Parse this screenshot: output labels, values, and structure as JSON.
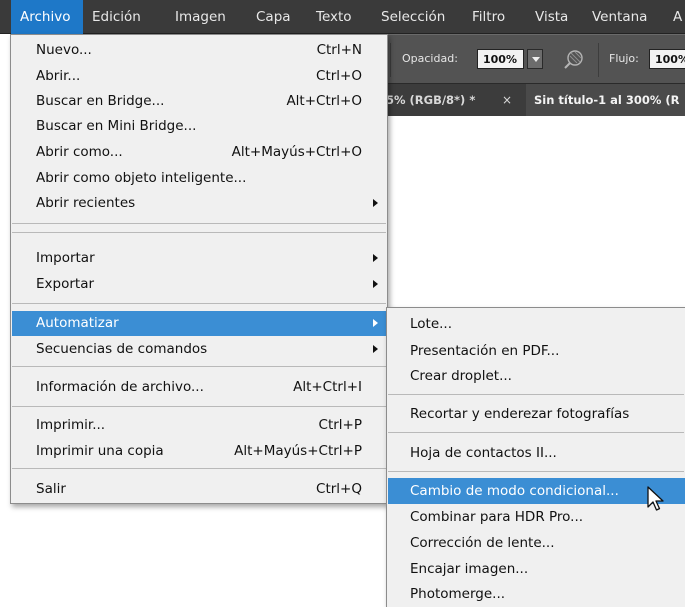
{
  "menubar": {
    "items": [
      "Archivo",
      "Edición",
      "Imagen",
      "Capa",
      "Texto",
      "Selección",
      "Filtro",
      "Vista",
      "Ventana",
      "A"
    ],
    "active_index": 0
  },
  "options_bar": {
    "opacity_label": "Opacidad:",
    "opacity_value": "100%",
    "flow_label": "Flujo:",
    "flow_value": "100%",
    "airbrush_icon": "airbrush-icon"
  },
  "document_tabs": [
    {
      "label": "5% (RGB/8*) *",
      "close": "×"
    },
    {
      "label": "Sin título-1 al 300% (R"
    }
  ],
  "file_menu": {
    "items": [
      {
        "label": "Nuevo...",
        "shortcut": "Ctrl+N"
      },
      {
        "label": "Abrir...",
        "shortcut": "Ctrl+O"
      },
      {
        "label": "Buscar en Bridge...",
        "shortcut": "Alt+Ctrl+O"
      },
      {
        "label": "Buscar en Mini Bridge...",
        "shortcut": ""
      },
      {
        "label": "Abrir como...",
        "shortcut": "Alt+Mayús+Ctrl+O"
      },
      {
        "label": "Abrir como objeto inteligente...",
        "shortcut": ""
      },
      {
        "label": "Abrir recientes",
        "submenu": true
      },
      {
        "label": "Importar",
        "submenu": true
      },
      {
        "label": "Exportar",
        "submenu": true
      },
      {
        "label": "Automatizar",
        "submenu": true,
        "highlighted": true
      },
      {
        "label": "Secuencias de comandos",
        "submenu": true
      },
      {
        "label": "Información de archivo...",
        "shortcut": "Alt+Ctrl+I"
      },
      {
        "label": "Imprimir...",
        "shortcut": "Ctrl+P"
      },
      {
        "label": "Imprimir una copia",
        "shortcut": "Alt+Mayús+Ctrl+P"
      },
      {
        "label": "Salir",
        "shortcut": "Ctrl+Q"
      }
    ]
  },
  "automate_submenu": {
    "items": [
      {
        "label": "Lote..."
      },
      {
        "label": "Presentación en PDF..."
      },
      {
        "label": "Crear droplet..."
      },
      {
        "label": "Recortar y enderezar fotografías"
      },
      {
        "label": "Hoja de contactos II..."
      },
      {
        "label": "Cambio de modo condicional...",
        "highlighted": true
      },
      {
        "label": "Combinar para HDR Pro..."
      },
      {
        "label": "Corrección de lente..."
      },
      {
        "label": "Encajar imagen..."
      },
      {
        "label": "Photomerge..."
      }
    ]
  },
  "colors": {
    "menubar_bg": "#3a3a3a",
    "highlight": "#3b8ed4",
    "active_menu": "#1e78c8",
    "menu_bg": "#f0f0f0"
  }
}
